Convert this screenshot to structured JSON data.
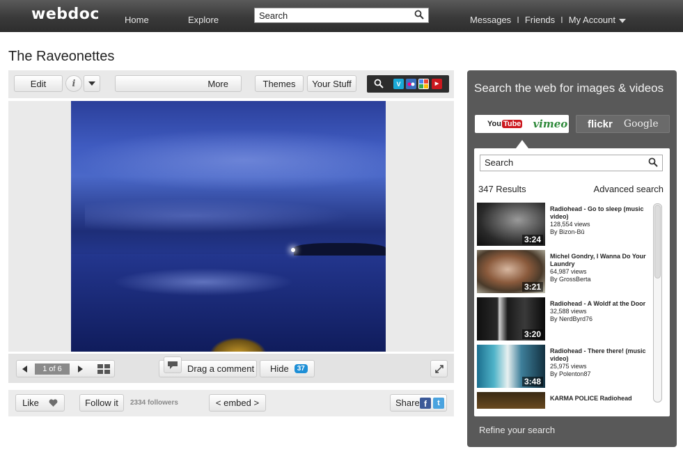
{
  "topbar": {
    "logo": "webdoc",
    "home": "Home",
    "explore": "Explore",
    "search_placeholder": "Search",
    "messages": "Messages",
    "friends": "Friends",
    "account": "My Account",
    "separator": "I"
  },
  "page": {
    "title": "The Raveonettes"
  },
  "toolbar": {
    "edit": "Edit",
    "info": "i",
    "more": "More",
    "themes": "Themes",
    "your_stuff": "Your Stuff",
    "services": [
      "vimeo",
      "flickr",
      "google",
      "youtube"
    ]
  },
  "navbar": {
    "page_counter": "1 of 6",
    "drag_comment": "Drag a comment",
    "hide": "Hide",
    "comment_count": "37"
  },
  "social": {
    "like": "Like",
    "follow": "Follow it",
    "followers": "2334 followers",
    "embed": "< embed >",
    "share": "Share"
  },
  "right_panel": {
    "title": "Search the web for images & videos",
    "tabs": {
      "youtube_you": "You",
      "youtube_tube": "Tube",
      "vimeo": "vimeo",
      "flickr": "flickr",
      "google": "Google"
    },
    "search_placeholder": "Search",
    "results_count": "347 Results",
    "advanced": "Advanced search",
    "results": [
      {
        "title": "Radiohead - Go to sleep (music video)",
        "views": "128,554 views",
        "by": "By Bizon-Bû",
        "duration": "3:24"
      },
      {
        "title": "Michel Gondry, I Wanna Do Your Laundry",
        "views": "64,987 views",
        "by": "By GrossBerta",
        "duration": "3:21"
      },
      {
        "title": "Radiohead - A Woldf at the Door",
        "views": "32,588 views",
        "by": "By NerdByrd76",
        "duration": "3:20"
      },
      {
        "title": "Radiohead - There there! (music video)",
        "views": "25,975 views",
        "by": "By Polenton87",
        "duration": "3:48"
      },
      {
        "title": "KARMA POLICE Radiohead",
        "views": "",
        "by": "",
        "duration": ""
      }
    ],
    "refine": "Refine your search"
  },
  "colors": {
    "topbar": "#3a3a3a",
    "panel": "#595959",
    "facebook": "#3b5998",
    "twitter": "#4aa3df",
    "comment_badge": "#1e8fd6",
    "youtube_red": "#cc181e",
    "vimeo_green": "#2f8a3b"
  }
}
